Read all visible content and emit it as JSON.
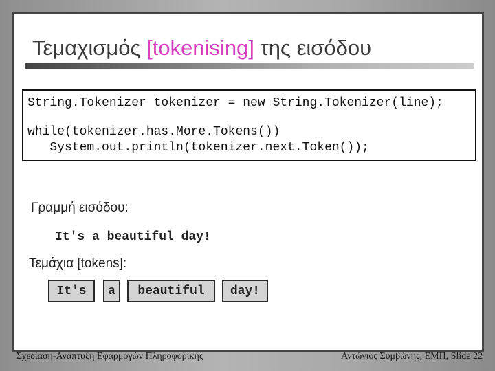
{
  "slide": {
    "title": {
      "prefix": "Τεμαχισμός ",
      "accent": "[tokenising]",
      "suffix": " της εισόδου",
      "accent_color": "#d63fbf"
    },
    "code": {
      "lines": [
        "String.Tokenizer tokenizer = new String.Tokenizer(line);",
        "while(tokenizer.has.More.Tokens())",
        "   System.out.println(tokenizer.next.Token());"
      ]
    },
    "input_label": "Γραμμή εισόδου:",
    "input_line": "It's a beautiful day!",
    "tokens_label": "Τεμάχια [tokens]:",
    "tokens": [
      "It's",
      "a",
      "beautiful",
      "day!"
    ]
  },
  "footer": {
    "left": "Σχεδίαση-Ανάπτυξη Εφαρμογών Πληροφορικής",
    "right": "Αντώνιος Συμβώνης, ΕΜΠ, Slide 22"
  }
}
